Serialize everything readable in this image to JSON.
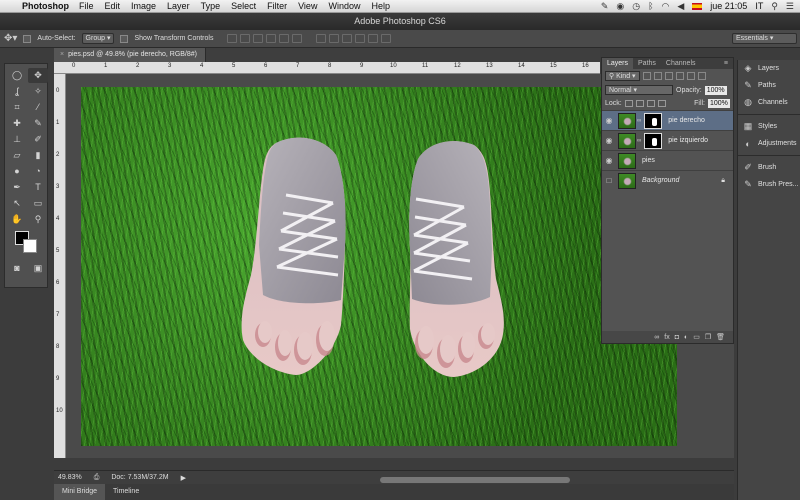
{
  "menubar": {
    "app_name": "Photoshop",
    "items": [
      "File",
      "Edit",
      "Image",
      "Layer",
      "Type",
      "Select",
      "Filter",
      "View",
      "Window",
      "Help"
    ],
    "clock": "jue 21:05",
    "input_source": "IT"
  },
  "window": {
    "title": "Adobe Photoshop CS6"
  },
  "options_bar": {
    "auto_select_label": "Auto-Select:",
    "auto_select_value": "Group",
    "show_transform_label": "Show Transform Controls",
    "workspace": "Essentials"
  },
  "document": {
    "tab_title": "pies.psd @ 49.8% (pie derecho, RGB/8#)"
  },
  "ruler": {
    "top_ticks": [
      "0",
      "1",
      "2",
      "3",
      "4",
      "5",
      "6",
      "7",
      "8",
      "9",
      "10",
      "11",
      "12",
      "13",
      "14",
      "15",
      "16"
    ],
    "left_ticks": [
      "0",
      "1",
      "2",
      "3",
      "4",
      "5",
      "6",
      "7",
      "8",
      "9",
      "10"
    ]
  },
  "status": {
    "zoom": "49.83%",
    "doc_size": "Doc: 7.53M/37.2M"
  },
  "bottom_tabs": [
    "Mini Bridge",
    "Timeline"
  ],
  "layers_panel": {
    "tabs": [
      "Layers",
      "Paths",
      "Channels"
    ],
    "kind_label": "Kind",
    "blend_mode": "Normal",
    "opacity_label": "Opacity:",
    "opacity_value": "100%",
    "lock_label": "Lock:",
    "fill_label": "Fill:",
    "fill_value": "100%",
    "layers": [
      {
        "name": "pie derecho",
        "selected": true
      },
      {
        "name": "pie izquierdo",
        "selected": false
      },
      {
        "name": "pies",
        "selected": false
      },
      {
        "name": "Background",
        "selected": false
      }
    ]
  },
  "dock": {
    "items": [
      "Layers",
      "Paths",
      "Channels",
      "Styles",
      "Adjustments",
      "Brush",
      "Brush Pres..."
    ]
  }
}
